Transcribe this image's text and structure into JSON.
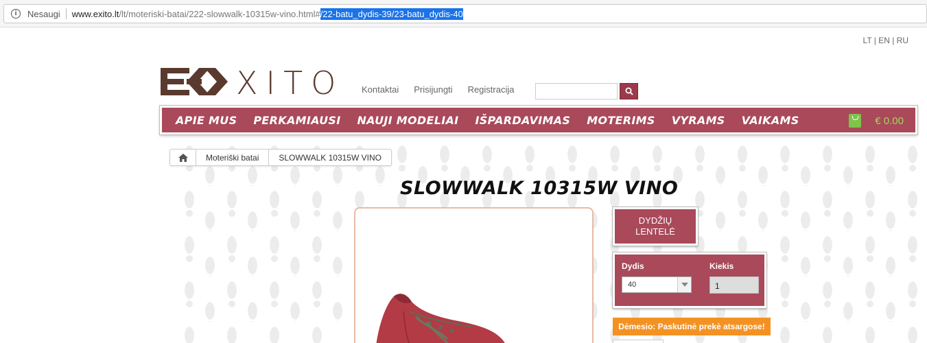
{
  "browser": {
    "security_label": "Nesaugi",
    "url_host": "www.exito.lt",
    "url_path": "/lt/moteriski-batai/222-slowwalk-10315w-vino.html#",
    "url_selected": "/22-batu_dydis-39/23-batu_dydis-40"
  },
  "languages": "LT | EN | RU",
  "header": {
    "logo_text": "XITO",
    "links": [
      "Kontaktai",
      "Prisijungti",
      "Registracija"
    ],
    "search_placeholder": ""
  },
  "nav": {
    "items": [
      "APIE MUS",
      "PERKAMIAUSI",
      "NAUJI MODELIAI",
      "IŠPARDAVIMAS",
      "MOTERIMS",
      "VYRAMS",
      "VAIKAMS"
    ],
    "cart_total": "€ 0.00"
  },
  "breadcrumb": [
    "Moteriški batai",
    "SLOWWALK 10315W VINO"
  ],
  "product": {
    "title": "SLOWWALK 10315W VINO",
    "size_table_label": "DYDŽIŲ LENTELĖ",
    "size_label": "Dydis",
    "size_value": "40",
    "qty_label": "Kiekis",
    "qty_value": "1",
    "warning": "Dėmesio: Paskutinė prekė atsargose!"
  },
  "colors": {
    "brand": "#a9495a",
    "logo": "#5a3a2e",
    "warning": "#f39223",
    "cart": "#a6d65c"
  },
  "icons": [
    "info-icon",
    "search-icon",
    "cart-icon",
    "home-icon",
    "chevron-down-icon"
  ]
}
